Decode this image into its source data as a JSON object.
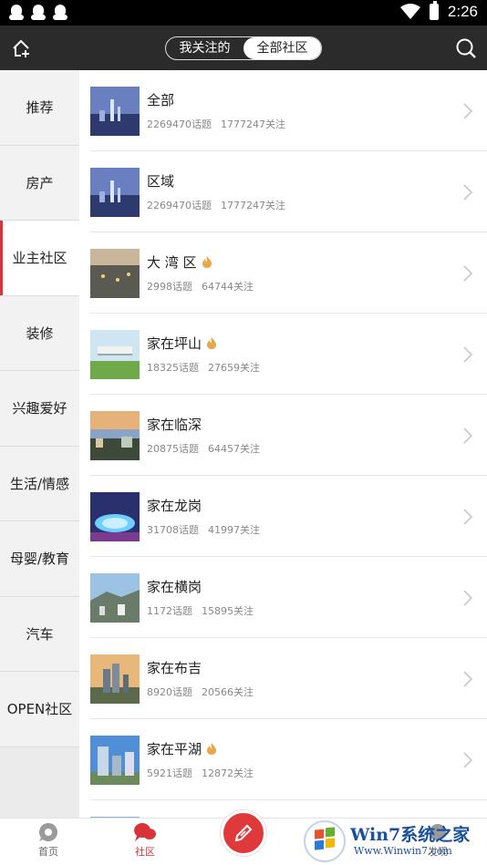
{
  "status_bar": {
    "time": "2:26"
  },
  "header": {
    "tabs": [
      {
        "label": "我关注的",
        "active": false
      },
      {
        "label": "全部社区",
        "active": true
      }
    ]
  },
  "sidebar": {
    "items": [
      {
        "label": "推荐"
      },
      {
        "label": "房产"
      },
      {
        "label": "业主社区",
        "active": true
      },
      {
        "label": "装修"
      },
      {
        "label": "兴趣爱好"
      },
      {
        "label": "生活/情感"
      },
      {
        "label": "母婴/教育"
      },
      {
        "label": "汽车"
      },
      {
        "label": "OPEN社区"
      }
    ]
  },
  "communities": [
    {
      "name": "全部",
      "topics": "2269470话题",
      "followers": "1777247关注",
      "hot": false
    },
    {
      "name": "区域",
      "topics": "2269470话题",
      "followers": "1777247关注",
      "hot": false
    },
    {
      "name": "大 湾 区",
      "topics": "2998话题",
      "followers": "64744关注",
      "hot": true
    },
    {
      "name": "家在坪山",
      "topics": "18325话题",
      "followers": "27659关注",
      "hot": true
    },
    {
      "name": "家在临深",
      "topics": "20875话题",
      "followers": "64457关注",
      "hot": false
    },
    {
      "name": "家在龙岗",
      "topics": "31708话题",
      "followers": "41997关注",
      "hot": false
    },
    {
      "name": "家在横岗",
      "topics": "1172话题",
      "followers": "15895关注",
      "hot": false
    },
    {
      "name": "家在布吉",
      "topics": "8920话题",
      "followers": "20566关注",
      "hot": false
    },
    {
      "name": "家在平湖",
      "topics": "5921话题",
      "followers": "12872关注",
      "hot": true
    }
  ],
  "bottom_nav": {
    "home": "首页",
    "community": "社区",
    "discover": "发现"
  },
  "watermark": {
    "brand": "Win7系统之家",
    "url": "Www.Winwin7.com"
  },
  "colors": {
    "accent": "#d9333a",
    "header_bg": "#2b2b2b",
    "flame": "#e8a84a"
  }
}
